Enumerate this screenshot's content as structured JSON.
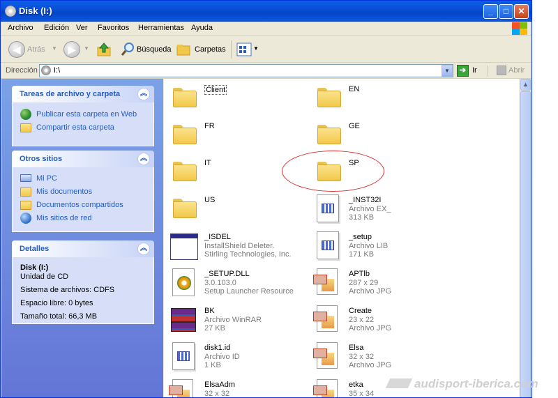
{
  "window": {
    "title": "Disk (I:)"
  },
  "menu": [
    "Archivo",
    "Edición",
    "Ver",
    "Favoritos",
    "Herramientas",
    "Ayuda"
  ],
  "toolbar": {
    "back": "Atrás",
    "search": "Búsqueda",
    "folders": "Carpetas"
  },
  "address": {
    "label": "Dirección",
    "value": "I:\\",
    "go": "Ir",
    "extra": "Abrir"
  },
  "sidebar": {
    "tasks": {
      "title": "Tareas de archivo y carpeta",
      "items": [
        "Publicar esta carpeta en Web",
        "Compartir esta carpeta"
      ]
    },
    "places": {
      "title": "Otros sitios",
      "items": [
        "Mi PC",
        "Mis documentos",
        "Documentos compartidos",
        "Mis sitios de red"
      ]
    },
    "details": {
      "title": "Detalles",
      "name": "Disk (I:)",
      "type": "Unidad de CD",
      "lines": [
        "Sistema de archivos: CDFS",
        "Espacio libre: 0 bytes",
        "Tamaño total: 66,3 MB"
      ]
    }
  },
  "files": [
    {
      "name": "Client",
      "kind": "folder"
    },
    {
      "name": "EN",
      "kind": "folder"
    },
    {
      "name": "FR",
      "kind": "folder"
    },
    {
      "name": "GE",
      "kind": "folder"
    },
    {
      "name": "IT",
      "kind": "folder"
    },
    {
      "name": "SP",
      "kind": "folder"
    },
    {
      "name": "US",
      "kind": "folder"
    },
    {
      "name": "_INST32I",
      "l2": "Archivo EX_",
      "l3": "313 KB",
      "kind": "doc"
    },
    {
      "name": "_ISDEL",
      "l2": "InstallShield Deleter.",
      "l3": "Stirling Technologies, Inc.",
      "kind": "app"
    },
    {
      "name": "_setup",
      "l2": "Archivo LIB",
      "l3": "171 KB",
      "kind": "doc"
    },
    {
      "name": "_SETUP.DLL",
      "l2": "3.0.103.0",
      "l3": "Setup Launcher Resource",
      "kind": "dll"
    },
    {
      "name": "APTlb",
      "l2": "287 x 29",
      "l3": "Archivo JPG",
      "kind": "jpg"
    },
    {
      "name": "BK",
      "l2": "Archivo WinRAR",
      "l3": "27 KB",
      "kind": "rar"
    },
    {
      "name": "Create",
      "l2": "23 x 22",
      "l3": "Archivo JPG",
      "kind": "jpg"
    },
    {
      "name": "disk1.id",
      "l2": "Archivo ID",
      "l3": "1 KB",
      "kind": "doc"
    },
    {
      "name": "Elsa",
      "l2": "32 x 32",
      "l3": "Archivo JPG",
      "kind": "jpg"
    },
    {
      "name": "ElsaAdm",
      "l2": "32 x 32",
      "kind": "jpg"
    },
    {
      "name": "etka",
      "l2": "35 x 34",
      "kind": "jpg"
    }
  ],
  "watermark": "audisport-iberica.com",
  "colors": {
    "titlebar": "#0a4fd6",
    "taskpane": "#6375d6",
    "link": "#215dc6",
    "highlight_ring": "#d83030"
  }
}
